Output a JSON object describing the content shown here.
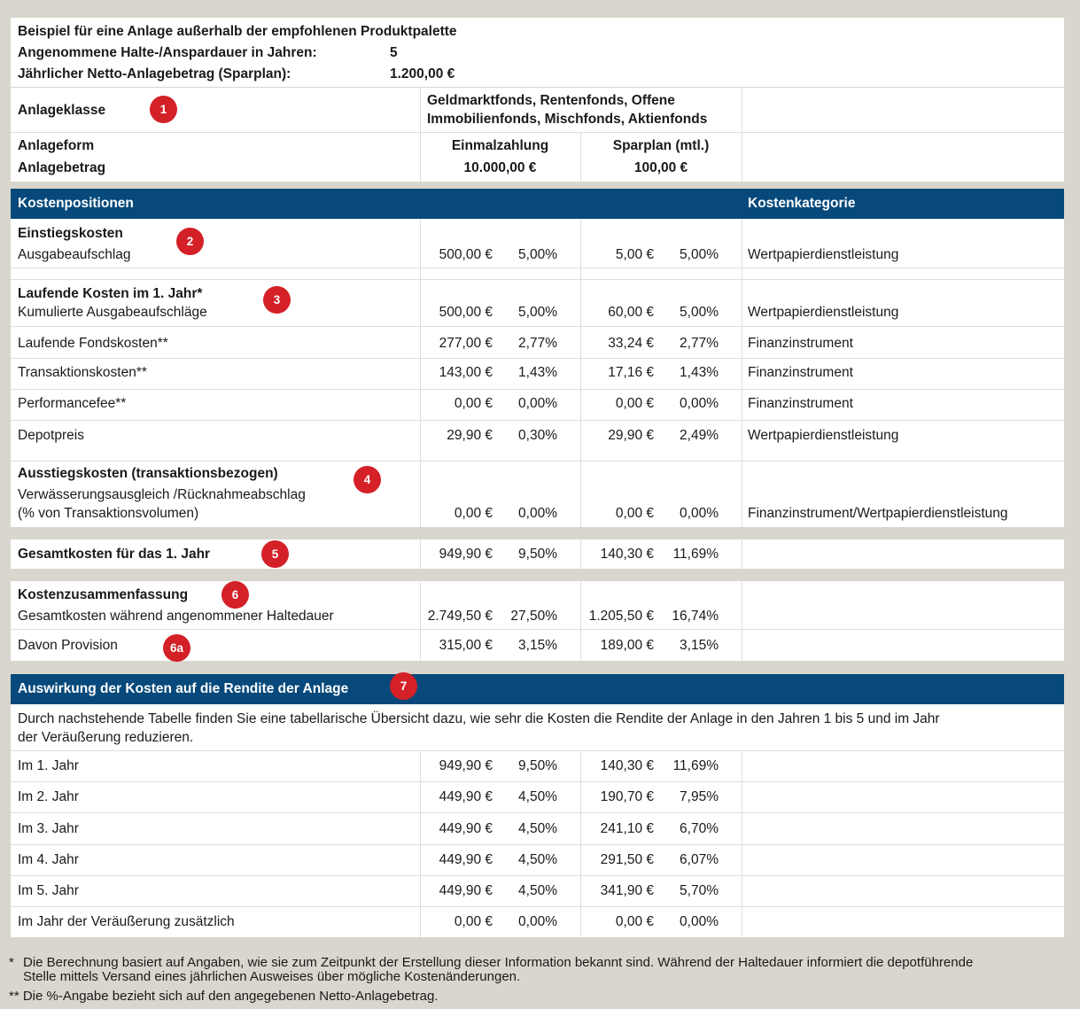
{
  "header": {
    "title": "Beispiel für eine Anlage außerhalb der empfohlenen Produktpalette",
    "duration_label": "Angenommene Halte-/Anspardauer in Jahren:",
    "duration_value": "5",
    "net_label": "Jährlicher Netto-Anlagebetrag (Sparplan):",
    "net_value": "1.200,00 €"
  },
  "asset": {
    "class_label": "Anlageklasse",
    "class_value_line1": "Geldmarktfonds, Rentenfonds, Offene",
    "class_value_line2": "Immobilienfonds, Mischfonds, Aktienfonds",
    "form_label": "Anlageform",
    "amount_label": "Anlagebetrag",
    "single_label": "Einmalzahlung",
    "single_amount": "10.000,00 €",
    "plan_label": "Sparplan (mtl.)",
    "plan_amount": "100,00 €"
  },
  "costs_header": {
    "left": "Kostenpositionen",
    "right": "Kostenkategorie"
  },
  "sections": {
    "entry": "Einstiegskosten",
    "running": "Laufende Kosten im 1. Jahr*",
    "exit": "Ausstiegskosten (transaktionsbezogen)"
  },
  "rows": [
    {
      "label": "Ausgabeaufschlag",
      "a1": "500,00 €",
      "p1": "5,00%",
      "a2": "5,00 €",
      "p2": "5,00%",
      "cat": "Wertpapierdienstleistung"
    },
    {
      "label": "Kumulierte Ausgabeaufschläge",
      "a1": "500,00 €",
      "p1": "5,00%",
      "a2": "60,00 €",
      "p2": "5,00%",
      "cat": "Wertpapierdienstleistung"
    },
    {
      "label": "Laufende Fondskosten**",
      "a1": "277,00 €",
      "p1": "2,77%",
      "a2": "33,24 €",
      "p2": "2,77%",
      "cat": "Finanzinstrument"
    },
    {
      "label": "Transaktionskosten**",
      "a1": "143,00 €",
      "p1": "1,43%",
      "a2": "17,16 €",
      "p2": "1,43%",
      "cat": "Finanzinstrument"
    },
    {
      "label": "Performancefee**",
      "a1": "0,00 €",
      "p1": "0,00%",
      "a2": "0,00 €",
      "p2": "0,00%",
      "cat": "Finanzinstrument"
    },
    {
      "label": "Depotpreis",
      "a1": "29,90 €",
      "p1": "0,30%",
      "a2": "29,90 €",
      "p2": "2,49%",
      "cat": "Wertpapierdienstleistung"
    },
    {
      "label": "Verwässerungsausgleich /Rücknahmeabschlag",
      "label2": "(% von Transaktionsvolumen)",
      "a1": "0,00 €",
      "p1": "0,00%",
      "a2": "0,00 €",
      "p2": "0,00%",
      "cat": "Finanzinstrument/Wertpapierdienstleistung"
    }
  ],
  "total": {
    "label": "Gesamtkosten für das 1. Jahr",
    "a1": "949,90 €",
    "p1": "9,50%",
    "a2": "140,30 €",
    "p2": "11,69%"
  },
  "summary": {
    "title": "Kostenzusammenfassung",
    "rows": [
      {
        "label": "Gesamtkosten während angenommener Haltedauer",
        "a1": "2.749,50 €",
        "p1": "27,50%",
        "a2": "1.205,50 €",
        "p2": "16,74%"
      },
      {
        "label": "Davon Provision",
        "a1": "315,00 €",
        "p1": "3,15%",
        "a2": "189,00 €",
        "p2": "3,15%"
      }
    ]
  },
  "impact": {
    "title": "Auswirkung der Kosten auf die Rendite der Anlage",
    "desc_line1": "Durch nachstehende Tabelle finden Sie eine tabellarische Übersicht dazu, wie sehr die Kosten die Rendite der Anlage in den Jahren 1 bis 5 und im Jahr",
    "desc_line2": "der Veräußerung reduzieren.",
    "rows": [
      {
        "label": "Im 1. Jahr",
        "a1": "949,90 €",
        "p1": "9,50%",
        "a2": "140,30 €",
        "p2": "11,69%"
      },
      {
        "label": "Im 2. Jahr",
        "a1": "449,90 €",
        "p1": "4,50%",
        "a2": "190,70 €",
        "p2": "7,95%"
      },
      {
        "label": "Im 3. Jahr",
        "a1": "449,90 €",
        "p1": "4,50%",
        "a2": "241,10 €",
        "p2": "6,70%"
      },
      {
        "label": "Im 4. Jahr",
        "a1": "449,90 €",
        "p1": "4,50%",
        "a2": "291,50 €",
        "p2": "6,07%"
      },
      {
        "label": "Im 5. Jahr",
        "a1": "449,90 €",
        "p1": "4,50%",
        "a2": "341,90 €",
        "p2": "5,70%"
      },
      {
        "label": "Im Jahr der Veräußerung zusätzlich",
        "a1": "0,00 €",
        "p1": "0,00%",
        "a2": "0,00 €",
        "p2": "0,00%"
      }
    ]
  },
  "badges": [
    "1",
    "2",
    "3",
    "4",
    "5",
    "6",
    "6a",
    "7"
  ],
  "footnotes": {
    "star_marker": "*",
    "star_line1": "Die Berechnung basiert auf Angaben, wie sie zum Zeitpunkt der Erstellung dieser Information bekannt sind. Während der Haltedauer informiert die depotführende",
    "star_line2": "Stelle mittels Versand eines jährlichen Ausweises über mögliche Kostenänderungen.",
    "dstar": "** Die %-Angabe bezieht sich auf den angegebenen Netto-Anlagebetrag."
  },
  "colors": {
    "band": "#06497a",
    "badge": "#d42027",
    "background": "#d9d6cd"
  }
}
